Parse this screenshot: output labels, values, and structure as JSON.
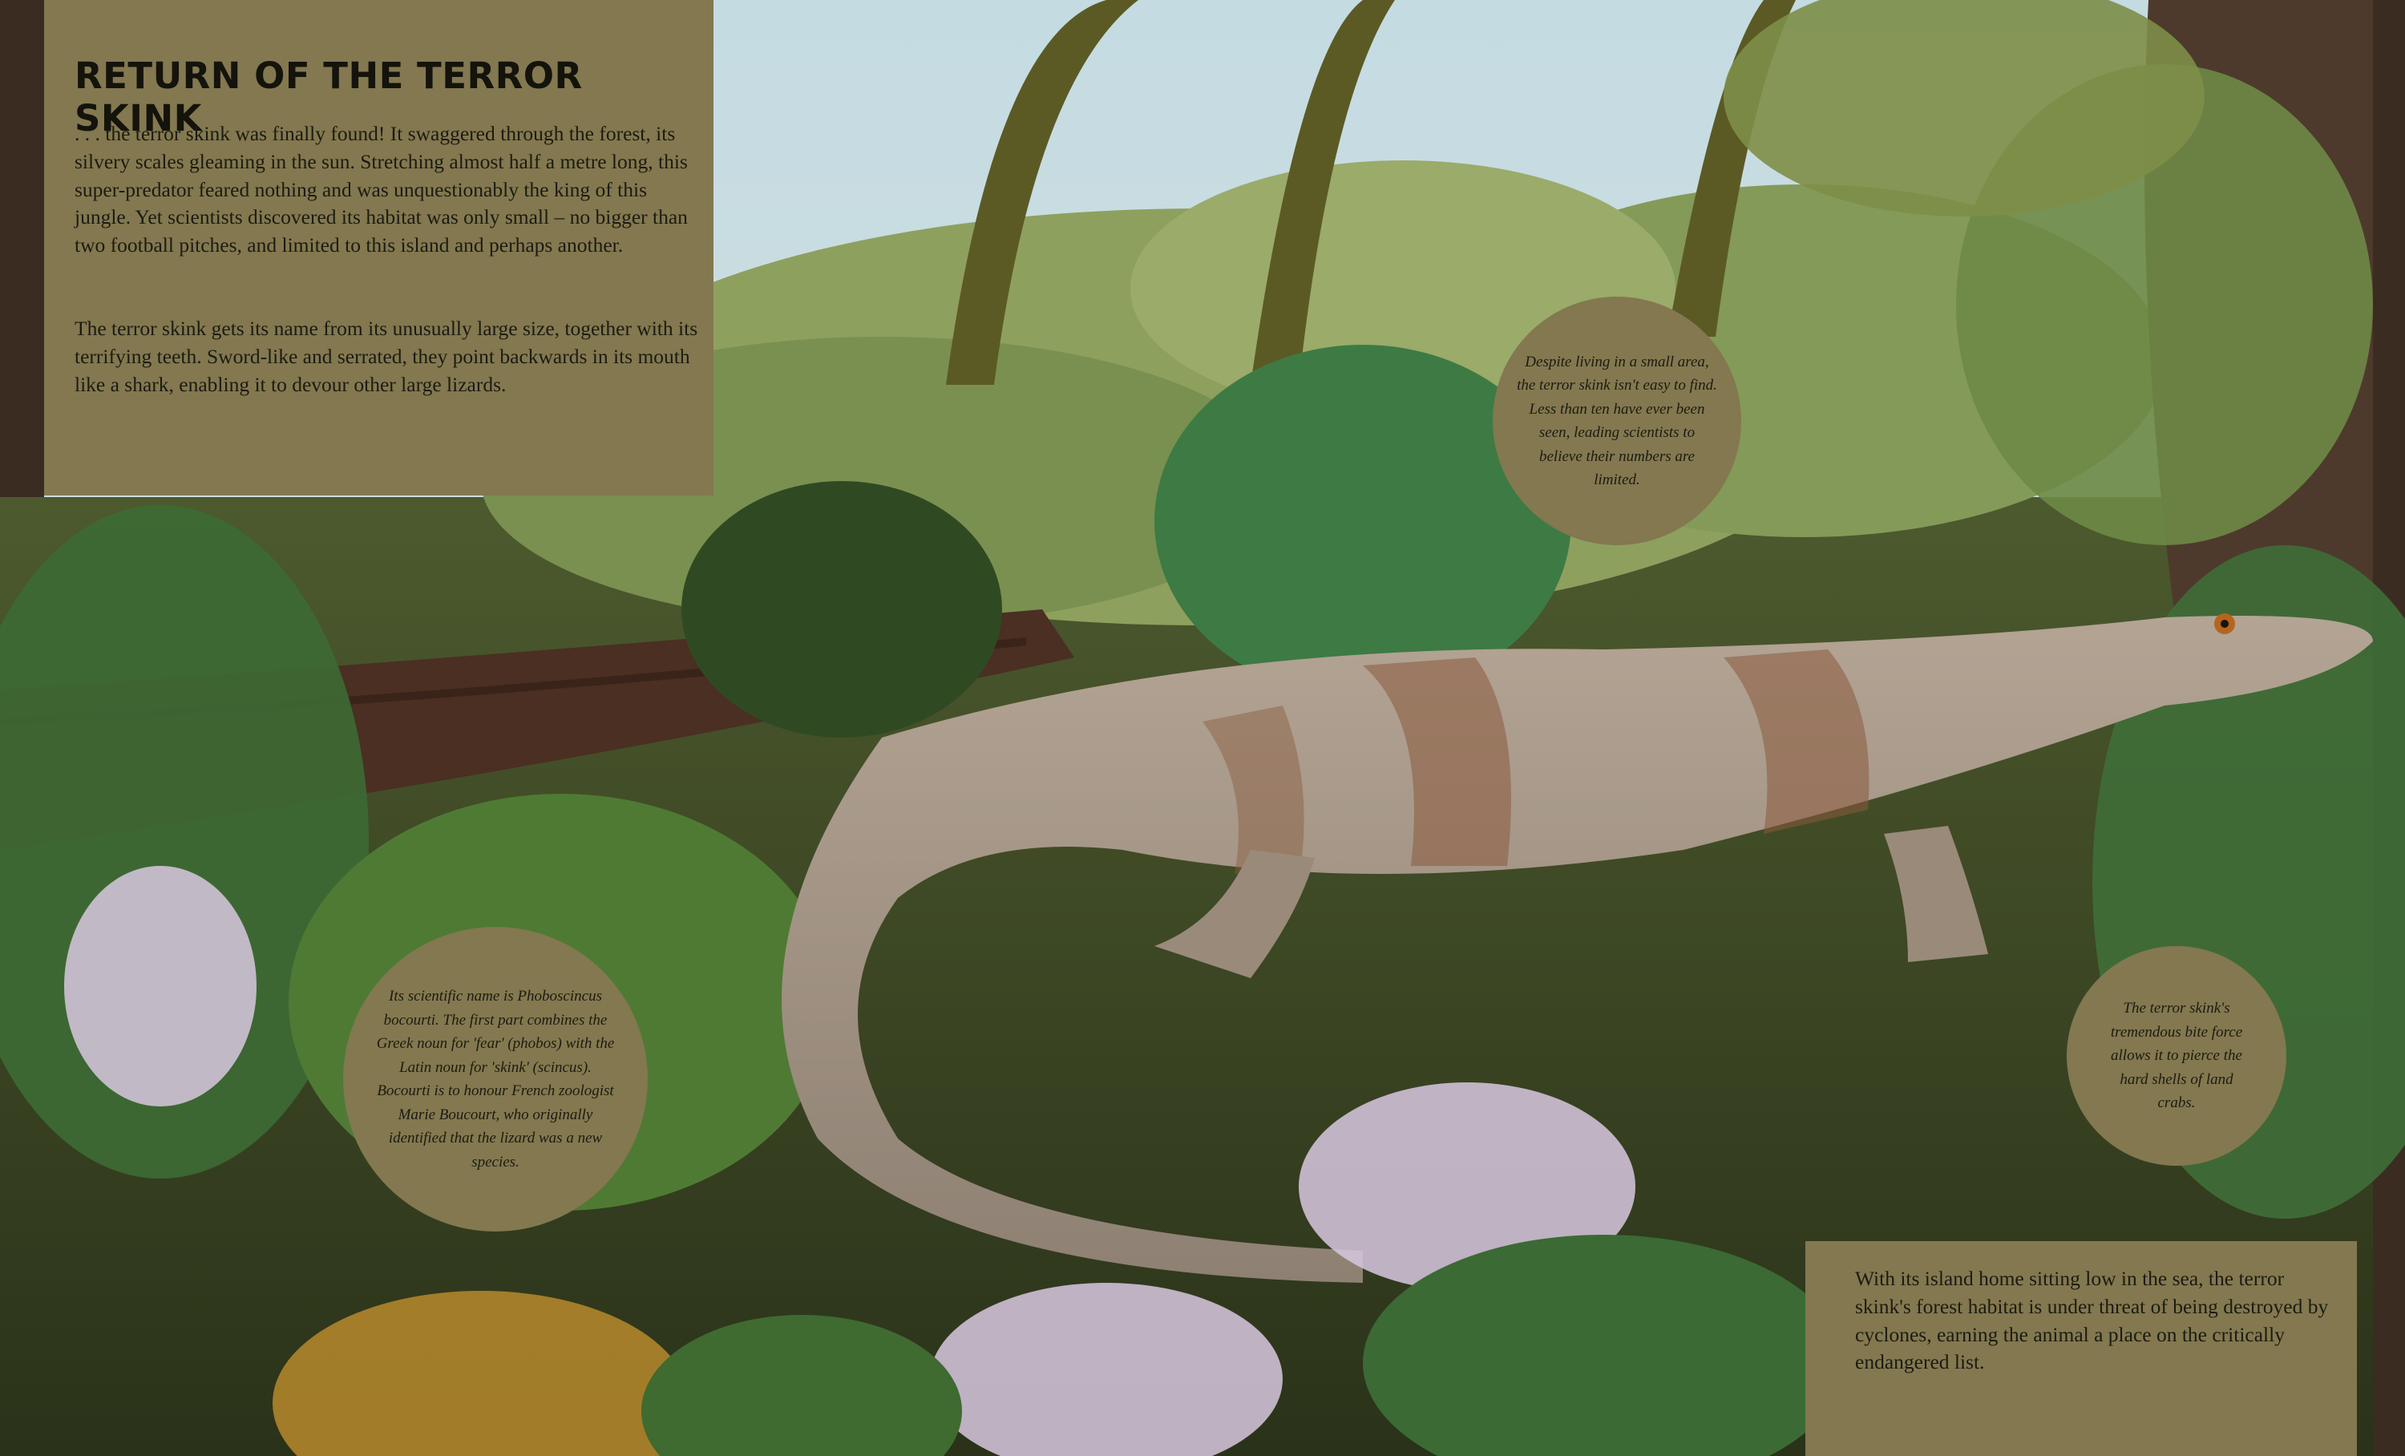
{
  "title": "RETURN OF THE TERROR SKINK",
  "paragraphs": [
    ". . . the terror skink was finally found! It swaggered through the forest, its silvery scales gleaming in the sun. Stretching almost half a metre long, this super-predator feared nothing and was unquestionably the king of this jungle. Yet scientists discovered its habitat was only small – no bigger than two football pitches, and limited to this island and perhaps another.",
    "The terror skink gets its name from its unusually large size, together with its terrifying teeth. Sword-like and serrated, they point backwards in its mouth like a shark, enabling it to devour other large lizards."
  ],
  "callouts": {
    "habitat_size": "Despite living in a small area, the terror skink isn't easy to find. Less than ten have ever been seen, leading scientists to believe their numbers are limited.",
    "scientific_name": "Its scientific name is Phoboscincus bocourti. The first part combines the Greek noun for 'fear' (phobos) with the Latin noun for 'skink' (scincus). Bocourti is to honour French zoologist Marie Boucourt, who originally identified that the lizard was a new species.",
    "bite_force": "The terror skink's tremendous bite force allows it to pierce the hard shells of land crabs."
  },
  "conservation_note": "With its island home sitting low in the sea, the terror skink's forest habitat is under threat of being destroyed by cyclones, earning the animal a place on the critically endangered list.",
  "palette": {
    "panel": "#83784f",
    "text": "#1c1b12",
    "sky": "#c9dde0",
    "foliage_dark": "#2f4a22",
    "foliage_mid": "#5f7a36",
    "foliage_light": "#8fa85a",
    "log": "#4a2f22",
    "skink": "#a89888",
    "skink_band": "#8a5a3c",
    "flower": "#d8c8e0"
  }
}
